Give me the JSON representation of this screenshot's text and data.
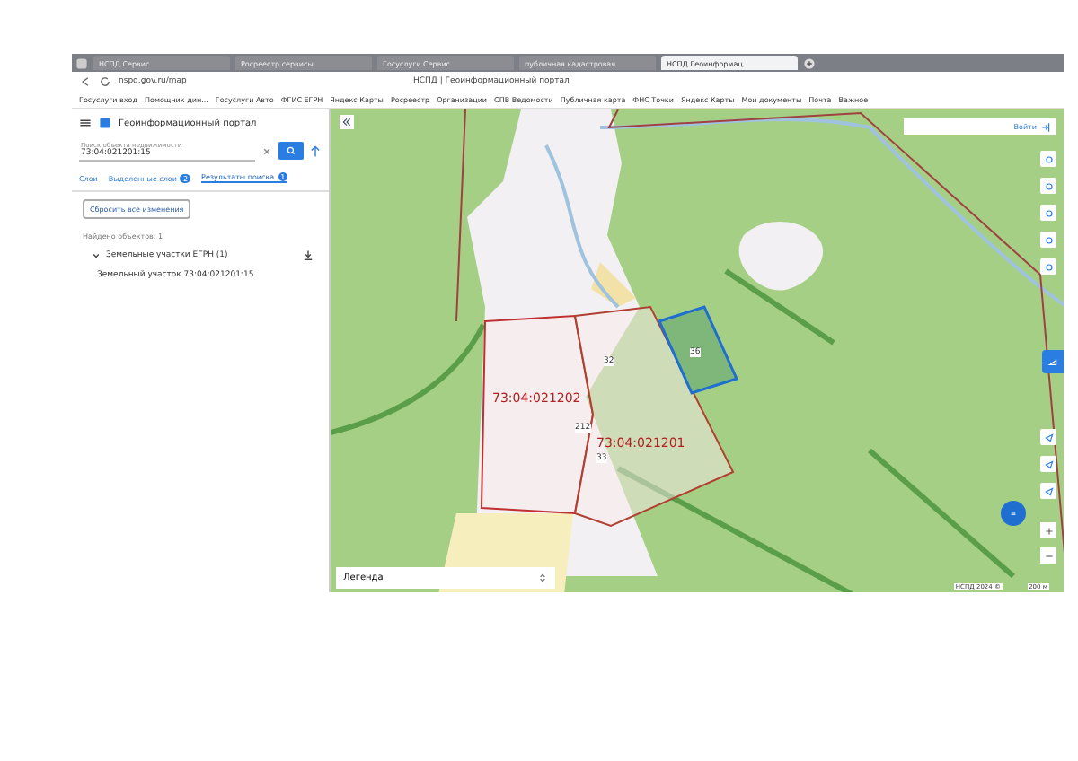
{
  "browser": {
    "tabs": [
      {
        "title": "НСПД Сервис",
        "selected": false
      },
      {
        "title": "Росреестр сервисы",
        "selected": false
      },
      {
        "title": "Госуслуги Сервис",
        "selected": false
      },
      {
        "title": "публичная кадастровая",
        "selected": false
      },
      {
        "title": "НСПД Геоинформац",
        "selected": true
      }
    ],
    "address": "nspd.gov.ru/map",
    "page_title": "НСПД | Геоинформационный портал",
    "bookmarks": [
      "Госуслуги вход",
      "Помощник дин...",
      "Госуслуги Авто",
      "ФГИС ЕГРН",
      "Яндекс Карты",
      "Росреестр",
      "Организации",
      "СПВ Ведомости",
      "Публичная карта",
      "ФНС Точки",
      "Яндекс Карты",
      "Мои документы",
      "Почта",
      "Важное"
    ]
  },
  "sidebar": {
    "title": "Геоинформационный портал",
    "search": {
      "label": "Поиск объекта недвижимости",
      "value": "73:04:021201:15"
    },
    "tabs": [
      {
        "label": "Слои",
        "selected": false
      },
      {
        "label": "Выделенные слои",
        "count": "2",
        "selected": false
      },
      {
        "label": "Результаты поиска",
        "count": "1",
        "selected": true
      }
    ],
    "reset_button": "Сбросить все изменения",
    "found": "Найдено объектов: 1",
    "group": "Земельные участки ЕГРН (1)",
    "result": "Земельный участок 73:04:021201:15"
  },
  "map": {
    "login": "Войти",
    "labels": [
      {
        "text": "73:04:021202",
        "kind": "parcel"
      },
      {
        "text": "73:04:021201",
        "kind": "parcel"
      },
      {
        "text": "32",
        "kind": "number"
      },
      {
        "text": "36",
        "kind": "number"
      },
      {
        "text": "212",
        "kind": "number"
      },
      {
        "text": "33",
        "kind": "number"
      }
    ],
    "legend": "Легенда",
    "attribution": "НСПД 2024 ©",
    "scale": "200 м"
  }
}
